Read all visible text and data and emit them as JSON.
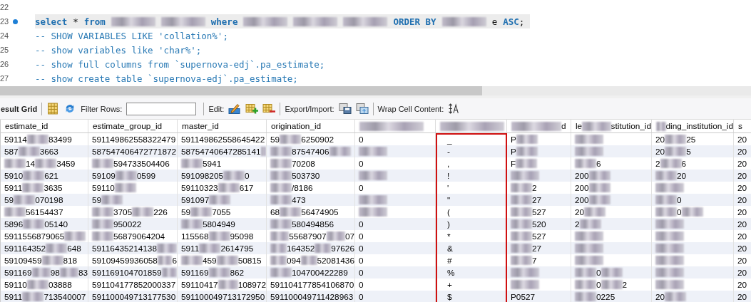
{
  "editor": {
    "lines": [
      {
        "number": "22",
        "current": false,
        "breakpoint": false
      },
      {
        "number": "23",
        "current": true,
        "breakpoint": true,
        "parts": [
          {
            "kind": "keyword",
            "text": "select"
          },
          {
            "kind": "plain",
            "text": "*"
          },
          {
            "kind": "keyword",
            "text": "from"
          },
          {
            "kind": "blur"
          },
          {
            "kind": "blur"
          },
          {
            "kind": "keyword",
            "text": "where"
          },
          {
            "kind": "blur"
          },
          {
            "kind": "blur"
          },
          {
            "kind": "blur"
          },
          {
            "kind": "keyword",
            "text": "ORDER BY"
          },
          {
            "kind": "blur"
          },
          {
            "kind": "plain",
            "text": "e"
          },
          {
            "kind": "keyword",
            "text": "ASC"
          },
          {
            "kind": "punct",
            "text": ";"
          }
        ]
      },
      {
        "number": "24",
        "current": false,
        "breakpoint": false,
        "parts": [
          {
            "kind": "comment",
            "text": "-- SHOW VARIABLES LIKE 'collation%';"
          }
        ]
      },
      {
        "number": "25",
        "current": false,
        "breakpoint": false,
        "parts": [
          {
            "kind": "comment",
            "text": "-- show variables like 'char%';"
          }
        ]
      },
      {
        "number": "26",
        "current": false,
        "breakpoint": false,
        "parts": [
          {
            "kind": "comment",
            "text": "-- show full columns from `supernova-edj`.pa_estimate;"
          }
        ]
      },
      {
        "number": "27",
        "current": false,
        "breakpoint": false,
        "parts": [
          {
            "kind": "comment",
            "text": "-- show create table `supernova-edj`.pa_estimate;"
          }
        ]
      }
    ]
  },
  "toolbar": {
    "title": "esult Grid",
    "filter_label": "Filter Rows:",
    "edit_label": "Edit:",
    "export_label": "Export/Import:",
    "wrap_label": "Wrap Cell Content:"
  },
  "table": {
    "columns": [
      {
        "label": [
          "estimate_id"
        ],
        "highlighted": false
      },
      {
        "label": [
          "estimate_group_id"
        ],
        "highlighted": false
      },
      {
        "label": [
          "master_id"
        ],
        "highlighted": false
      },
      {
        "label": [
          "origination_id"
        ],
        "highlighted": false
      },
      {
        "label": [
          {
            "kind": "blur"
          }
        ],
        "highlighted": false
      },
      {
        "label": [
          {
            "kind": "blur"
          }
        ],
        "highlighted": true
      },
      {
        "label": [
          {
            "kind": "blur"
          },
          "d"
        ],
        "highlighted": false
      },
      {
        "label": [
          "le",
          {
            "kind": "blur"
          },
          "stitution_id"
        ],
        "highlighted": false
      },
      {
        "label": [
          {
            "kind": "blur"
          },
          "ding_institution_id"
        ],
        "highlighted": false
      },
      {
        "label": [
          "s"
        ],
        "highlighted": false
      }
    ],
    "rows": [
      [
        [
          "59114",
          {
            "kind": "blur"
          },
          "83499"
        ],
        [
          "591149862558322479"
        ],
        [
          "591149862558645422"
        ],
        [
          "59",
          {
            "kind": "blur"
          },
          "6250902"
        ],
        [
          "0"
        ],
        [
          "_"
        ],
        [
          "P",
          {
            "kind": "blur"
          }
        ],
        [
          {
            "kind": "blur"
          }
        ],
        [
          "20",
          {
            "kind": "blur"
          },
          "25"
        ],
        [
          "20"
        ]
      ],
      [
        [
          "587",
          {
            "kind": "blur"
          },
          "3663"
        ],
        [
          "587547406472771872"
        ],
        [
          "58754740647285141",
          {
            "kind": "blur"
          }
        ],
        [
          {
            "kind": "blur"
          },
          "87547406",
          {
            "kind": "blur"
          }
        ],
        [
          {
            "kind": "blur"
          }
        ],
        [
          "-"
        ],
        [
          "P",
          {
            "kind": "blur"
          }
        ],
        [
          {
            "kind": "blur"
          }
        ],
        [
          "20",
          {
            "kind": "blur"
          },
          "5"
        ],
        [
          "20"
        ]
      ],
      [
        [
          {
            "kind": "blur"
          },
          "14",
          {
            "kind": "blur"
          },
          "3459"
        ],
        [
          {
            "kind": "blur"
          },
          "594733504406"
        ],
        [
          {
            "kind": "blur"
          },
          "5941"
        ],
        [
          {
            "kind": "blur"
          },
          "70208"
        ],
        [
          "0"
        ],
        [
          ","
        ],
        [
          "F",
          {
            "kind": "blur"
          }
        ],
        [
          {
            "kind": "blur"
          },
          "6"
        ],
        [
          "2",
          {
            "kind": "blur"
          },
          "6"
        ],
        [
          "20"
        ]
      ],
      [
        [
          "5910",
          {
            "kind": "blur"
          },
          "621"
        ],
        [
          "59109",
          {
            "kind": "blur"
          },
          "0599"
        ],
        [
          "591098205",
          {
            "kind": "blur"
          },
          "0"
        ],
        [
          {
            "kind": "blur"
          },
          "503730"
        ],
        [
          {
            "kind": "blur"
          }
        ],
        [
          "!"
        ],
        [
          {
            "kind": "blur"
          }
        ],
        [
          "200",
          {
            "kind": "blur"
          }
        ],
        [
          {
            "kind": "blur"
          },
          "20"
        ],
        [
          "20"
        ]
      ],
      [
        [
          "5911",
          {
            "kind": "blur"
          },
          "3635"
        ],
        [
          "59110",
          {
            "kind": "blur"
          }
        ],
        [
          "59110323",
          {
            "kind": "blur"
          },
          "617"
        ],
        [
          {
            "kind": "blur"
          },
          "/8186"
        ],
        [
          "0"
        ],
        [
          "'"
        ],
        [
          {
            "kind": "blur"
          },
          "2"
        ],
        [
          "200",
          {
            "kind": "blur"
          }
        ],
        [
          {
            "kind": "blur"
          }
        ],
        [
          "20"
        ]
      ],
      [
        [
          "59",
          {
            "kind": "blur"
          },
          "070198"
        ],
        [
          "59",
          {
            "kind": "blur"
          }
        ],
        [
          "591097",
          {
            "kind": "blur"
          }
        ],
        [
          {
            "kind": "blur"
          },
          "473"
        ],
        [
          {
            "kind": "blur"
          }
        ],
        [
          "\""
        ],
        [
          {
            "kind": "blur"
          },
          "27"
        ],
        [
          "200",
          {
            "kind": "blur"
          }
        ],
        [
          {
            "kind": "blur"
          },
          "0"
        ],
        [
          "20"
        ]
      ],
      [
        [
          {
            "kind": "blur"
          },
          "56154437"
        ],
        [
          {
            "kind": "blur"
          },
          "3705",
          {
            "kind": "blur"
          },
          "226"
        ],
        [
          "59",
          {
            "kind": "blur"
          },
          "7055"
        ],
        [
          "68",
          {
            "kind": "blur"
          },
          "56474905"
        ],
        [
          {
            "kind": "blur"
          }
        ],
        [
          "("
        ],
        [
          {
            "kind": "blur"
          },
          "527"
        ],
        [
          "20",
          {
            "kind": "blur"
          }
        ],
        [
          {
            "kind": "blur"
          },
          "0",
          {
            "kind": "blur"
          }
        ],
        [
          "20"
        ]
      ],
      [
        [
          "5896",
          {
            "kind": "blur"
          },
          "05140"
        ],
        [
          {
            "kind": "blur"
          },
          "950022"
        ],
        [
          {
            "kind": "blur"
          },
          "5804949"
        ],
        [
          {
            "kind": "blur"
          },
          "580494856"
        ],
        [
          "0"
        ],
        [
          ")"
        ],
        [
          {
            "kind": "blur"
          },
          "520"
        ],
        [
          "2",
          {
            "kind": "blur"
          }
        ],
        [
          {
            "kind": "blur"
          }
        ],
        [
          "20"
        ]
      ],
      [
        [
          "5911556879065",
          {
            "kind": "blur"
          }
        ],
        [
          {
            "kind": "blur"
          },
          "56879064204"
        ],
        [
          "115568",
          {
            "kind": "blur"
          },
          "95098"
        ],
        [
          {
            "kind": "blur"
          },
          "55687907",
          {
            "kind": "blur"
          },
          "07"
        ],
        [
          "0"
        ],
        [
          "*"
        ],
        [
          {
            "kind": "blur"
          },
          "527"
        ],
        [
          {
            "kind": "blur"
          }
        ],
        [
          {
            "kind": "blur"
          }
        ],
        [
          "20"
        ]
      ],
      [
        [
          "591164352",
          {
            "kind": "blur"
          },
          "648"
        ],
        [
          "59116435214138",
          {
            "kind": "blur"
          }
        ],
        [
          "5911",
          {
            "kind": "blur"
          },
          "2614795"
        ],
        [
          {
            "kind": "blur"
          },
          "164352",
          {
            "kind": "blur"
          },
          "97626"
        ],
        [
          "0"
        ],
        [
          "&"
        ],
        [
          {
            "kind": "blur"
          },
          "27"
        ],
        [
          {
            "kind": "blur"
          }
        ],
        [
          {
            "kind": "blur"
          }
        ],
        [
          "20"
        ]
      ],
      [
        [
          "59109459",
          {
            "kind": "blur"
          },
          "818"
        ],
        [
          "59109459936058",
          {
            "kind": "blur"
          },
          "6"
        ],
        [
          {
            "kind": "blur"
          },
          "459",
          {
            "kind": "blur"
          },
          "50815"
        ],
        [
          {
            "kind": "blur"
          },
          "094",
          {
            "kind": "blur"
          },
          "52081436"
        ],
        [
          "0"
        ],
        [
          "#"
        ],
        [
          {
            "kind": "blur"
          },
          "7"
        ],
        [
          {
            "kind": "blur"
          }
        ],
        [
          {
            "kind": "blur"
          }
        ],
        [
          "20"
        ]
      ],
      [
        [
          "591169",
          {
            "kind": "blur"
          },
          "98",
          {
            "kind": "blur"
          },
          "83"
        ],
        [
          "591169104701859",
          {
            "kind": "blur"
          }
        ],
        [
          "591169",
          {
            "kind": "blur"
          },
          "862"
        ],
        [
          {
            "kind": "blur"
          },
          "104700422289"
        ],
        [
          "0"
        ],
        [
          "%"
        ],
        [
          {
            "kind": "blur"
          }
        ],
        [
          {
            "kind": "blur"
          },
          "0",
          {
            "kind": "blur"
          }
        ],
        [
          {
            "kind": "blur"
          }
        ],
        [
          "20"
        ]
      ],
      [
        [
          "59110",
          {
            "kind": "blur"
          },
          "03888"
        ],
        [
          "591104177852000337"
        ],
        [
          "59110417",
          {
            "kind": "blur"
          },
          "108972"
        ],
        [
          "591104177854106870"
        ],
        [
          "0"
        ],
        [
          "+"
        ],
        [
          {
            "kind": "blur"
          }
        ],
        [
          {
            "kind": "blur"
          },
          "0",
          {
            "kind": "blur"
          },
          "2"
        ],
        [
          {
            "kind": "blur"
          }
        ],
        [
          "20"
        ]
      ],
      [
        [
          "5911",
          {
            "kind": "blur"
          },
          "713540007"
        ],
        [
          "591100049713177530"
        ],
        [
          "591100049713172950"
        ],
        [
          "591100049711428963"
        ],
        [
          "0"
        ],
        [
          "$"
        ],
        [
          "P0527"
        ],
        [
          {
            "kind": "blur"
          },
          "0225"
        ],
        [
          "20",
          {
            "kind": "blur"
          }
        ],
        [
          "20"
        ]
      ]
    ]
  }
}
